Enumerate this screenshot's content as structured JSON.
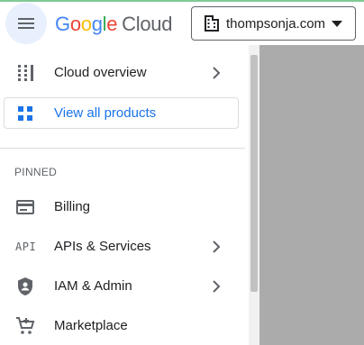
{
  "header": {
    "logo": {
      "letters": [
        {
          "char": "G",
          "color": "#4285f4"
        },
        {
          "char": "o",
          "color": "#ea4335"
        },
        {
          "char": "o",
          "color": "#fbbc04"
        },
        {
          "char": "g",
          "color": "#4285f4"
        },
        {
          "char": "l",
          "color": "#34a853"
        },
        {
          "char": "e",
          "color": "#ea4335"
        }
      ],
      "product": "Cloud"
    },
    "menu_icon": "hamburger-menu-icon",
    "org_selector": {
      "icon": "building-icon",
      "label": "thompsonja.com",
      "dropdown_icon": "caret-down-icon"
    }
  },
  "nav": {
    "cloud_overview": {
      "label": "Cloud overview",
      "icon": "dashboard-icon",
      "chevron": "chevron-right-icon"
    },
    "view_all": {
      "label": "View all products",
      "icon": "apps-grid-icon"
    },
    "pinned": {
      "label": "PINNED",
      "items": [
        {
          "label": "Billing",
          "icon": "billing-card-icon"
        },
        {
          "label": "APIs & Services",
          "icon_text": "API",
          "chevron": "chevron-right-icon"
        },
        {
          "label": "IAM & Admin",
          "icon": "shield-person-icon",
          "chevron": "chevron-right-icon"
        },
        {
          "label": "Marketplace",
          "icon": "shopping-cart-icon"
        }
      ]
    }
  },
  "colors": {
    "accent": "#1a73e8",
    "menu_button_bg": "#e8f0fe",
    "icon_gray": "#5f6368",
    "scrim": "#ababab"
  }
}
